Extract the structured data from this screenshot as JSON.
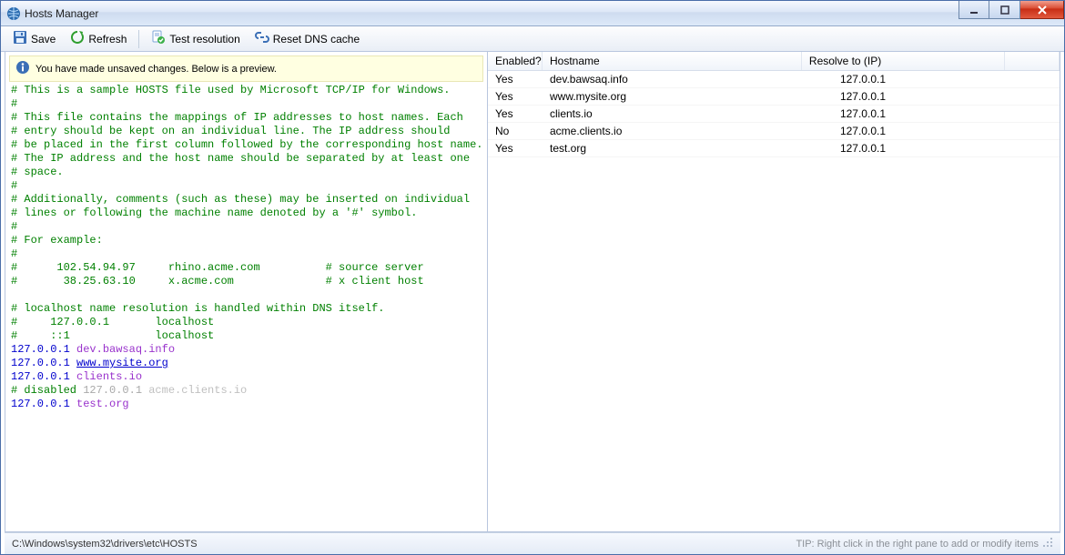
{
  "window": {
    "title": "Hosts Manager"
  },
  "toolbar": {
    "save": "Save",
    "refresh": "Refresh",
    "test": "Test resolution",
    "reset": "Reset DNS cache"
  },
  "notice": "You have made unsaved changes. Below is a preview.",
  "editor": {
    "comment_lines": [
      "# This is a sample HOSTS file used by Microsoft TCP/IP for Windows.",
      "#",
      "# This file contains the mappings of IP addresses to host names. Each",
      "# entry should be kept on an individual line. The IP address should",
      "# be placed in the first column followed by the corresponding host name.",
      "# The IP address and the host name should be separated by at least one",
      "# space.",
      "#",
      "# Additionally, comments (such as these) may be inserted on individual",
      "# lines or following the machine name denoted by a '#' symbol.",
      "#",
      "# For example:",
      "#",
      "#      102.54.94.97     rhino.acme.com          # source server",
      "#       38.25.63.10     x.acme.com              # x client host",
      "",
      "# localhost name resolution is handled within DNS itself.",
      "#     127.0.0.1       localhost",
      "#     ::1             localhost"
    ],
    "entries": [
      {
        "ip": "127.0.0.1",
        "host": "dev.bawsaq.info",
        "link": false,
        "disabled": false
      },
      {
        "ip": "127.0.0.1",
        "host": "www.mysite.org",
        "link": true,
        "disabled": false
      },
      {
        "ip": "127.0.0.1",
        "host": "clients.io",
        "link": false,
        "disabled": false
      },
      {
        "ip": "127.0.0.1",
        "host": "acme.clients.io",
        "link": false,
        "disabled": true,
        "prefix": "# disabled"
      },
      {
        "ip": "127.0.0.1",
        "host": "test.org",
        "link": false,
        "disabled": false
      }
    ]
  },
  "table": {
    "headers": {
      "c1": "Enabled?",
      "c2": "Hostname",
      "c3": "Resolve to (IP)"
    },
    "rows": [
      {
        "enabled": "Yes",
        "host": "dev.bawsaq.info",
        "ip": "127.0.0.1"
      },
      {
        "enabled": "Yes",
        "host": "www.mysite.org",
        "ip": "127.0.0.1"
      },
      {
        "enabled": "Yes",
        "host": "clients.io",
        "ip": "127.0.0.1"
      },
      {
        "enabled": "No",
        "host": "acme.clients.io",
        "ip": "127.0.0.1"
      },
      {
        "enabled": "Yes",
        "host": "test.org",
        "ip": "127.0.0.1"
      }
    ]
  },
  "status": {
    "path": "C:\\Windows\\system32\\drivers\\etc\\HOSTS",
    "tip": "TIP: Right click in the right pane to add or modify items"
  }
}
